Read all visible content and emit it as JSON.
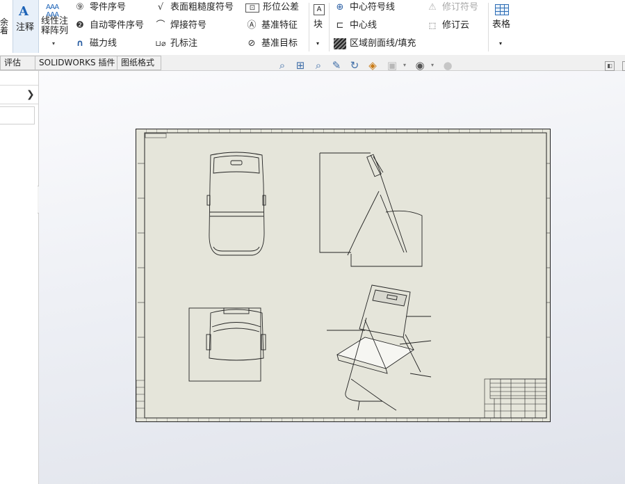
{
  "ribbon": {
    "cut_label": "余\n着",
    "annotation": {
      "label": "注释",
      "icon": "note-A-icon"
    },
    "linear_note": {
      "line1": "线性注",
      "line2": "释阵列",
      "icon": "linear-note-pattern-icon"
    },
    "col1": [
      {
        "label": "零件序号",
        "icon": "balloon-icon"
      },
      {
        "label": "自动零件序号",
        "icon": "auto-balloon-icon"
      },
      {
        "label": "磁力线",
        "icon": "magnetic-line-icon"
      }
    ],
    "col2": [
      {
        "label": "表面粗糙度符号",
        "icon": "surface-finish-icon"
      },
      {
        "label": "焊接符号",
        "icon": "weld-symbol-icon"
      },
      {
        "label": "孔标注",
        "icon": "hole-callout-icon"
      }
    ],
    "col3": [
      {
        "label": "形位公差",
        "icon": "geometric-tolerance-icon"
      },
      {
        "label": "基准特征",
        "icon": "datum-feature-icon"
      },
      {
        "label": "基准目标",
        "icon": "datum-target-icon"
      }
    ],
    "block": {
      "label": "块",
      "icon": "block-icon"
    },
    "col4": [
      {
        "label": "中心符号线",
        "icon": "center-mark-icon"
      },
      {
        "label": "中心线",
        "icon": "centerline-icon"
      },
      {
        "label": "区域剖面线/填充",
        "icon": "area-hatch-icon"
      }
    ],
    "col5": [
      {
        "label": "修订符号",
        "icon": "revision-symbol-icon",
        "enabled": false
      },
      {
        "label": "修订云",
        "icon": "revision-cloud-icon",
        "enabled": true
      }
    ],
    "table": {
      "label": "表格",
      "icon": "table-icon"
    }
  },
  "tabs": [
    "评估",
    "SOLIDWORKS 插件",
    "图纸格式"
  ]
}
